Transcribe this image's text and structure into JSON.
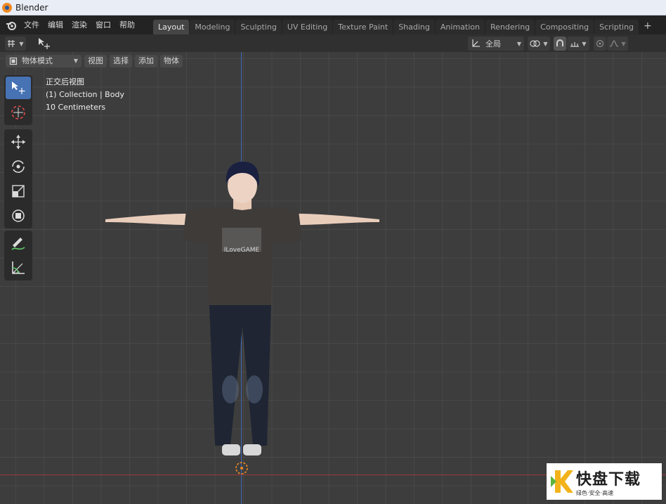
{
  "window": {
    "title": "Blender"
  },
  "menu": [
    "文件",
    "编辑",
    "渲染",
    "窗口",
    "帮助"
  ],
  "workspaces": [
    {
      "label": "Layout",
      "active": true
    },
    {
      "label": "Modeling"
    },
    {
      "label": "Sculpting"
    },
    {
      "label": "UV Editing"
    },
    {
      "label": "Texture Paint"
    },
    {
      "label": "Shading"
    },
    {
      "label": "Animation"
    },
    {
      "label": "Rendering"
    },
    {
      "label": "Compositing"
    },
    {
      "label": "Scripting"
    }
  ],
  "header": {
    "transform_orientation": "全局"
  },
  "viewport_menu": {
    "mode": "物体模式",
    "items": [
      "视图",
      "选择",
      "添加",
      "物体"
    ]
  },
  "overlay_info": {
    "view_name": "正交后视图",
    "collection": "(1) Collection | Body",
    "scale": "10 Centimeters"
  },
  "character": {
    "shirt_text": "ILoveGAME"
  },
  "watermark": {
    "brand": "快盘下载",
    "tagline": "绿色·安全·高速"
  },
  "colors": {
    "accent": "#4772b3",
    "x_axis": "#9a3a3a",
    "z_axis": "#3b66b8"
  }
}
